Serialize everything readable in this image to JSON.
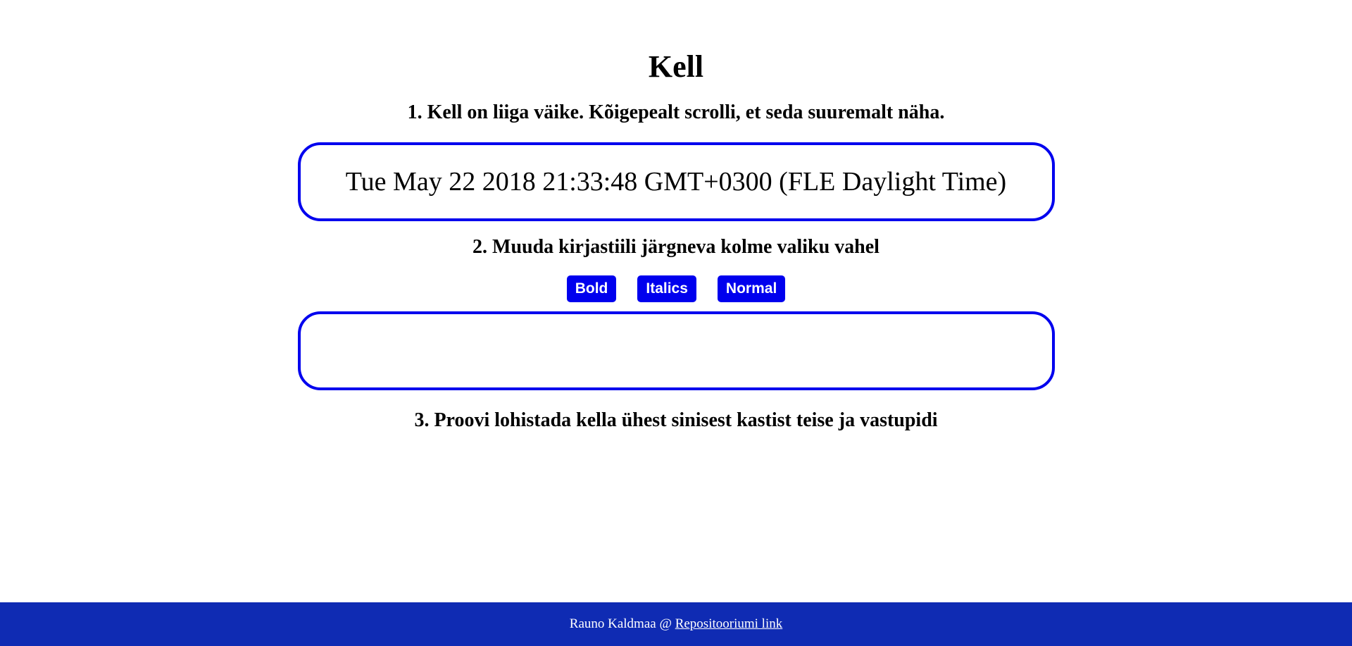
{
  "page": {
    "title": "Kell"
  },
  "steps": {
    "step1": "1. Kell on liiga väike. Kõigepealt scrolli, et seda suuremalt näha.",
    "step2": "2. Muuda kirjastiili järgneva kolme valiku vahel",
    "step3": "3. Proovi lohistada kella ühest sinisest kastist teise ja vastupidi"
  },
  "clock": {
    "text": "Tue May 22 2018 21:33:48 GMT+0300 (FLE Daylight Time)"
  },
  "font_buttons": {
    "bold": "Bold",
    "italics": "Italics",
    "normal": "Normal"
  },
  "footer": {
    "author": "Rauno Kaldmaa @ ",
    "link_label": "Repositooriumi link"
  },
  "colors": {
    "accent": "#0000ee",
    "footer_bg": "#0f2bb3",
    "background": "#ffffff"
  }
}
